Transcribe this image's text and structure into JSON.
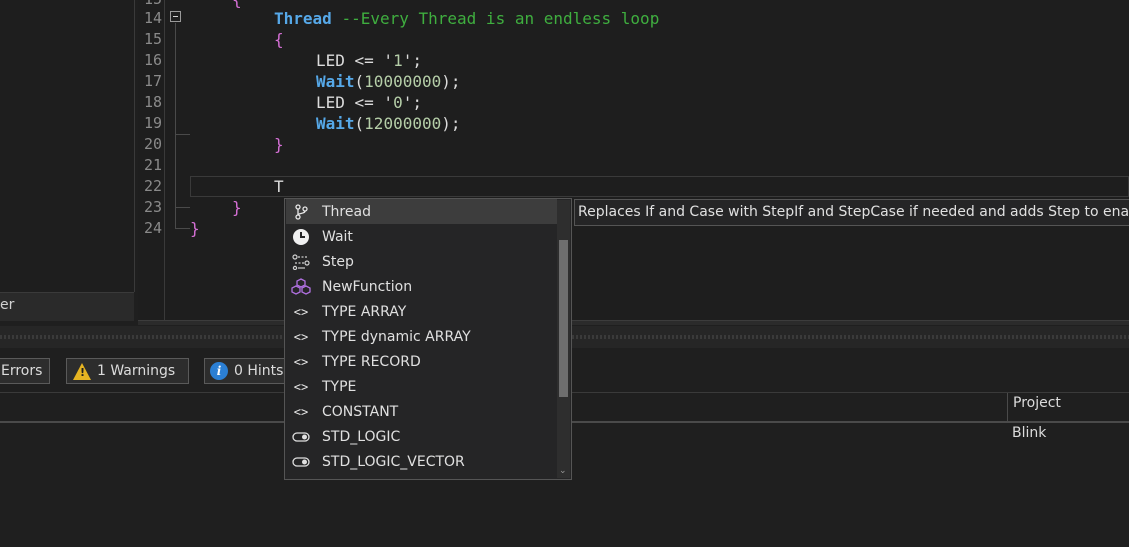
{
  "left_panel": {
    "label_fragment": "er"
  },
  "editor": {
    "lines": [
      {
        "number": "15"
      },
      {
        "number": "14"
      },
      {
        "number": "15"
      },
      {
        "number": "16"
      },
      {
        "number": "17"
      },
      {
        "number": "18"
      },
      {
        "number": "19"
      },
      {
        "number": "20"
      },
      {
        "number": "21"
      },
      {
        "number": "22"
      },
      {
        "number": "23"
      },
      {
        "number": "24"
      }
    ],
    "code": {
      "l14_kw": "Thread",
      "l14_comment": "--Every Thread is an endless loop",
      "l15": "{",
      "l16_a": "LED <= '",
      "l16_val": "1",
      "l16_b": "';",
      "l17_fn": "Wait",
      "l17_open": "(",
      "l17_num": "10000000",
      "l17_close": ");",
      "l18_a": "LED <= '",
      "l18_val": "0",
      "l18_b": "';",
      "l19_fn": "Wait",
      "l19_open": "(",
      "l19_num": "12000000",
      "l19_close": ");",
      "l20": "}",
      "l22": "T",
      "l23": "}",
      "l24": "}",
      "l13_partial": "{"
    }
  },
  "toolbar": {
    "errors_label": "Errors",
    "warnings_label": "1 Warnings",
    "hints_label": "0 Hints"
  },
  "grid": {
    "column_project": "Project",
    "row_project_value": "Blink"
  },
  "autocomplete": {
    "items": [
      {
        "label": "Thread",
        "icon": "branch-icon",
        "selected": true
      },
      {
        "label": "Wait",
        "icon": "clock-icon"
      },
      {
        "label": "Step",
        "icon": "steps-icon"
      },
      {
        "label": "NewFunction",
        "icon": "cubes-icon"
      },
      {
        "label": "TYPE ARRAY",
        "icon": "angle-brackets-icon"
      },
      {
        "label": "TYPE dynamic ARRAY",
        "icon": "angle-brackets-icon"
      },
      {
        "label": "TYPE RECORD",
        "icon": "angle-brackets-icon"
      },
      {
        "label": "TYPE",
        "icon": "angle-brackets-icon"
      },
      {
        "label": "CONSTANT",
        "icon": "angle-brackets-icon"
      },
      {
        "label": "STD_LOGIC",
        "icon": "toggle-icon"
      },
      {
        "label": "STD_LOGIC_VECTOR",
        "icon": "toggle-icon"
      }
    ],
    "tooltip": "Replaces If and Case with StepIf and StepCase if needed and adds Step to enab"
  },
  "colors": {
    "keyword": "#56a8e8",
    "comment": "#3fae3f",
    "brace": "#d670d6",
    "number": "#b5cea8",
    "warning": "#e6b422",
    "info": "#2b7fd4"
  }
}
